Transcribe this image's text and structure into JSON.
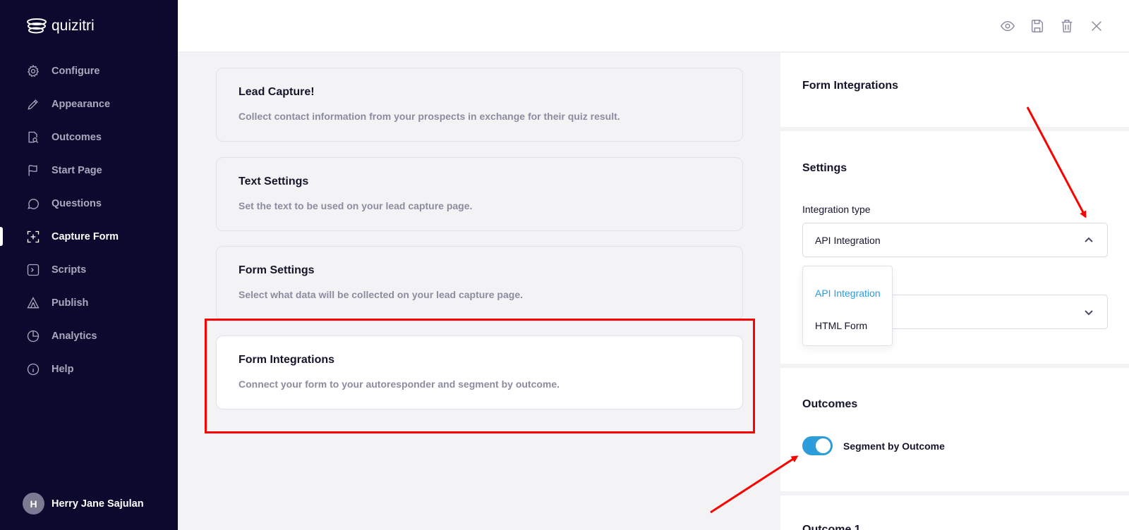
{
  "app": {
    "brand": "quizitri"
  },
  "sidebar": {
    "items": [
      {
        "label": "Configure",
        "icon": "gear-icon"
      },
      {
        "label": "Appearance",
        "icon": "pencil-icon"
      },
      {
        "label": "Outcomes",
        "icon": "document-search-icon"
      },
      {
        "label": "Start Page",
        "icon": "flag-icon"
      },
      {
        "label": "Questions",
        "icon": "chat-bubble-icon"
      },
      {
        "label": "Capture Form",
        "icon": "capture-icon",
        "active": true
      },
      {
        "label": "Scripts",
        "icon": "terminal-icon"
      },
      {
        "label": "Publish",
        "icon": "triangle-icon"
      },
      {
        "label": "Analytics",
        "icon": "pie-chart-icon"
      },
      {
        "label": "Help",
        "icon": "info-icon"
      }
    ],
    "user": {
      "initial": "H",
      "name": "Herry Jane Sajulan"
    }
  },
  "topbar": {
    "icons": [
      "eye-icon",
      "save-icon",
      "trash-icon",
      "close-icon"
    ]
  },
  "cards": [
    {
      "title": "Lead Capture!",
      "description": "Collect contact information from your prospects in exchange for their quiz result."
    },
    {
      "title": "Text Settings",
      "description": "Set the text to be used on your lead capture page."
    },
    {
      "title": "Form Settings",
      "description": "Select what data will be collected on your lead capture page."
    },
    {
      "title": "Form Integrations",
      "description": "Connect your form to your autoresponder and segment by outcome.",
      "active": true
    }
  ],
  "panel": {
    "title": "Form Integrations",
    "settings": {
      "title": "Settings",
      "integration_type_label": "Integration type",
      "integration_type_value": "API Integration",
      "options": [
        "API Integration",
        "HTML Form"
      ]
    },
    "outcomes": {
      "title": "Outcomes",
      "segment_label": "Segment by Outcome",
      "segment_enabled": true
    },
    "next_section_title": "Outcome 1"
  },
  "colors": {
    "sidebar_bg": "#0b0a2e",
    "accent": "#2d9cdb",
    "annotation": "#ff0000"
  }
}
